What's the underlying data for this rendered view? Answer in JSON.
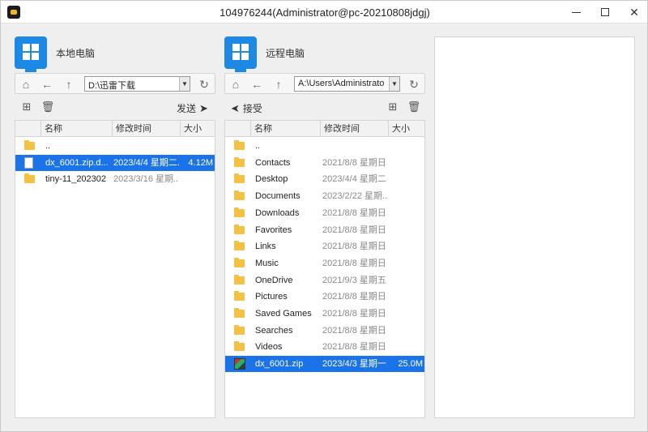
{
  "window": {
    "title": "104976244(Administrator@pc-20210808jdgj)"
  },
  "local": {
    "label": "本地电脑",
    "path": "D:\\迅雷下载",
    "send_label": "发送",
    "columns": [
      "名称",
      "修改时间",
      "大小"
    ],
    "rows": [
      {
        "icon": "folder-icon",
        "name": "..",
        "time": "",
        "size": ""
      },
      {
        "icon": "file-icon",
        "name": "dx_6001.zip.d...",
        "time": "2023/4/4 星期二...",
        "size": "4.12M",
        "selected": true
      },
      {
        "icon": "folder-icon",
        "name": "tiny-11_202302",
        "time": "2023/3/16 星期...",
        "size": ""
      }
    ]
  },
  "remote": {
    "label": "远程电脑",
    "path": "A:\\Users\\Administrato",
    "receive_label": "接受",
    "columns": [
      "名称",
      "修改时间",
      "大小"
    ],
    "rows": [
      {
        "icon": "folder-icon",
        "name": "..",
        "time": "",
        "size": ""
      },
      {
        "icon": "folder-icon",
        "name": "Contacts",
        "time": "2021/8/8 星期日...",
        "size": ""
      },
      {
        "icon": "folder-icon",
        "name": "Desktop",
        "time": "2023/4/4 星期二...",
        "size": ""
      },
      {
        "icon": "folder-icon",
        "name": "Documents",
        "time": "2023/2/22 星期...",
        "size": ""
      },
      {
        "icon": "folder-icon",
        "name": "Downloads",
        "time": "2021/8/8 星期日...",
        "size": ""
      },
      {
        "icon": "folder-icon",
        "name": "Favorites",
        "time": "2021/8/8 星期日...",
        "size": ""
      },
      {
        "icon": "folder-icon",
        "name": "Links",
        "time": "2021/8/8 星期日...",
        "size": ""
      },
      {
        "icon": "folder-icon",
        "name": "Music",
        "time": "2021/8/8 星期日...",
        "size": ""
      },
      {
        "icon": "folder-icon",
        "name": "OneDrive",
        "time": "2021/9/3 星期五...",
        "size": ""
      },
      {
        "icon": "folder-icon",
        "name": "Pictures",
        "time": "2021/8/8 星期日...",
        "size": ""
      },
      {
        "icon": "folder-icon",
        "name": "Saved Games",
        "time": "2021/8/8 星期日...",
        "size": ""
      },
      {
        "icon": "folder-icon",
        "name": "Searches",
        "time": "2021/8/8 星期日...",
        "size": ""
      },
      {
        "icon": "folder-icon",
        "name": "Videos",
        "time": "2021/8/8 星期日...",
        "size": ""
      },
      {
        "icon": "zip-icon",
        "name": "dx_6001.zip",
        "time": "2023/4/3 星期一...",
        "size": "25.0M",
        "selected": true
      }
    ]
  }
}
